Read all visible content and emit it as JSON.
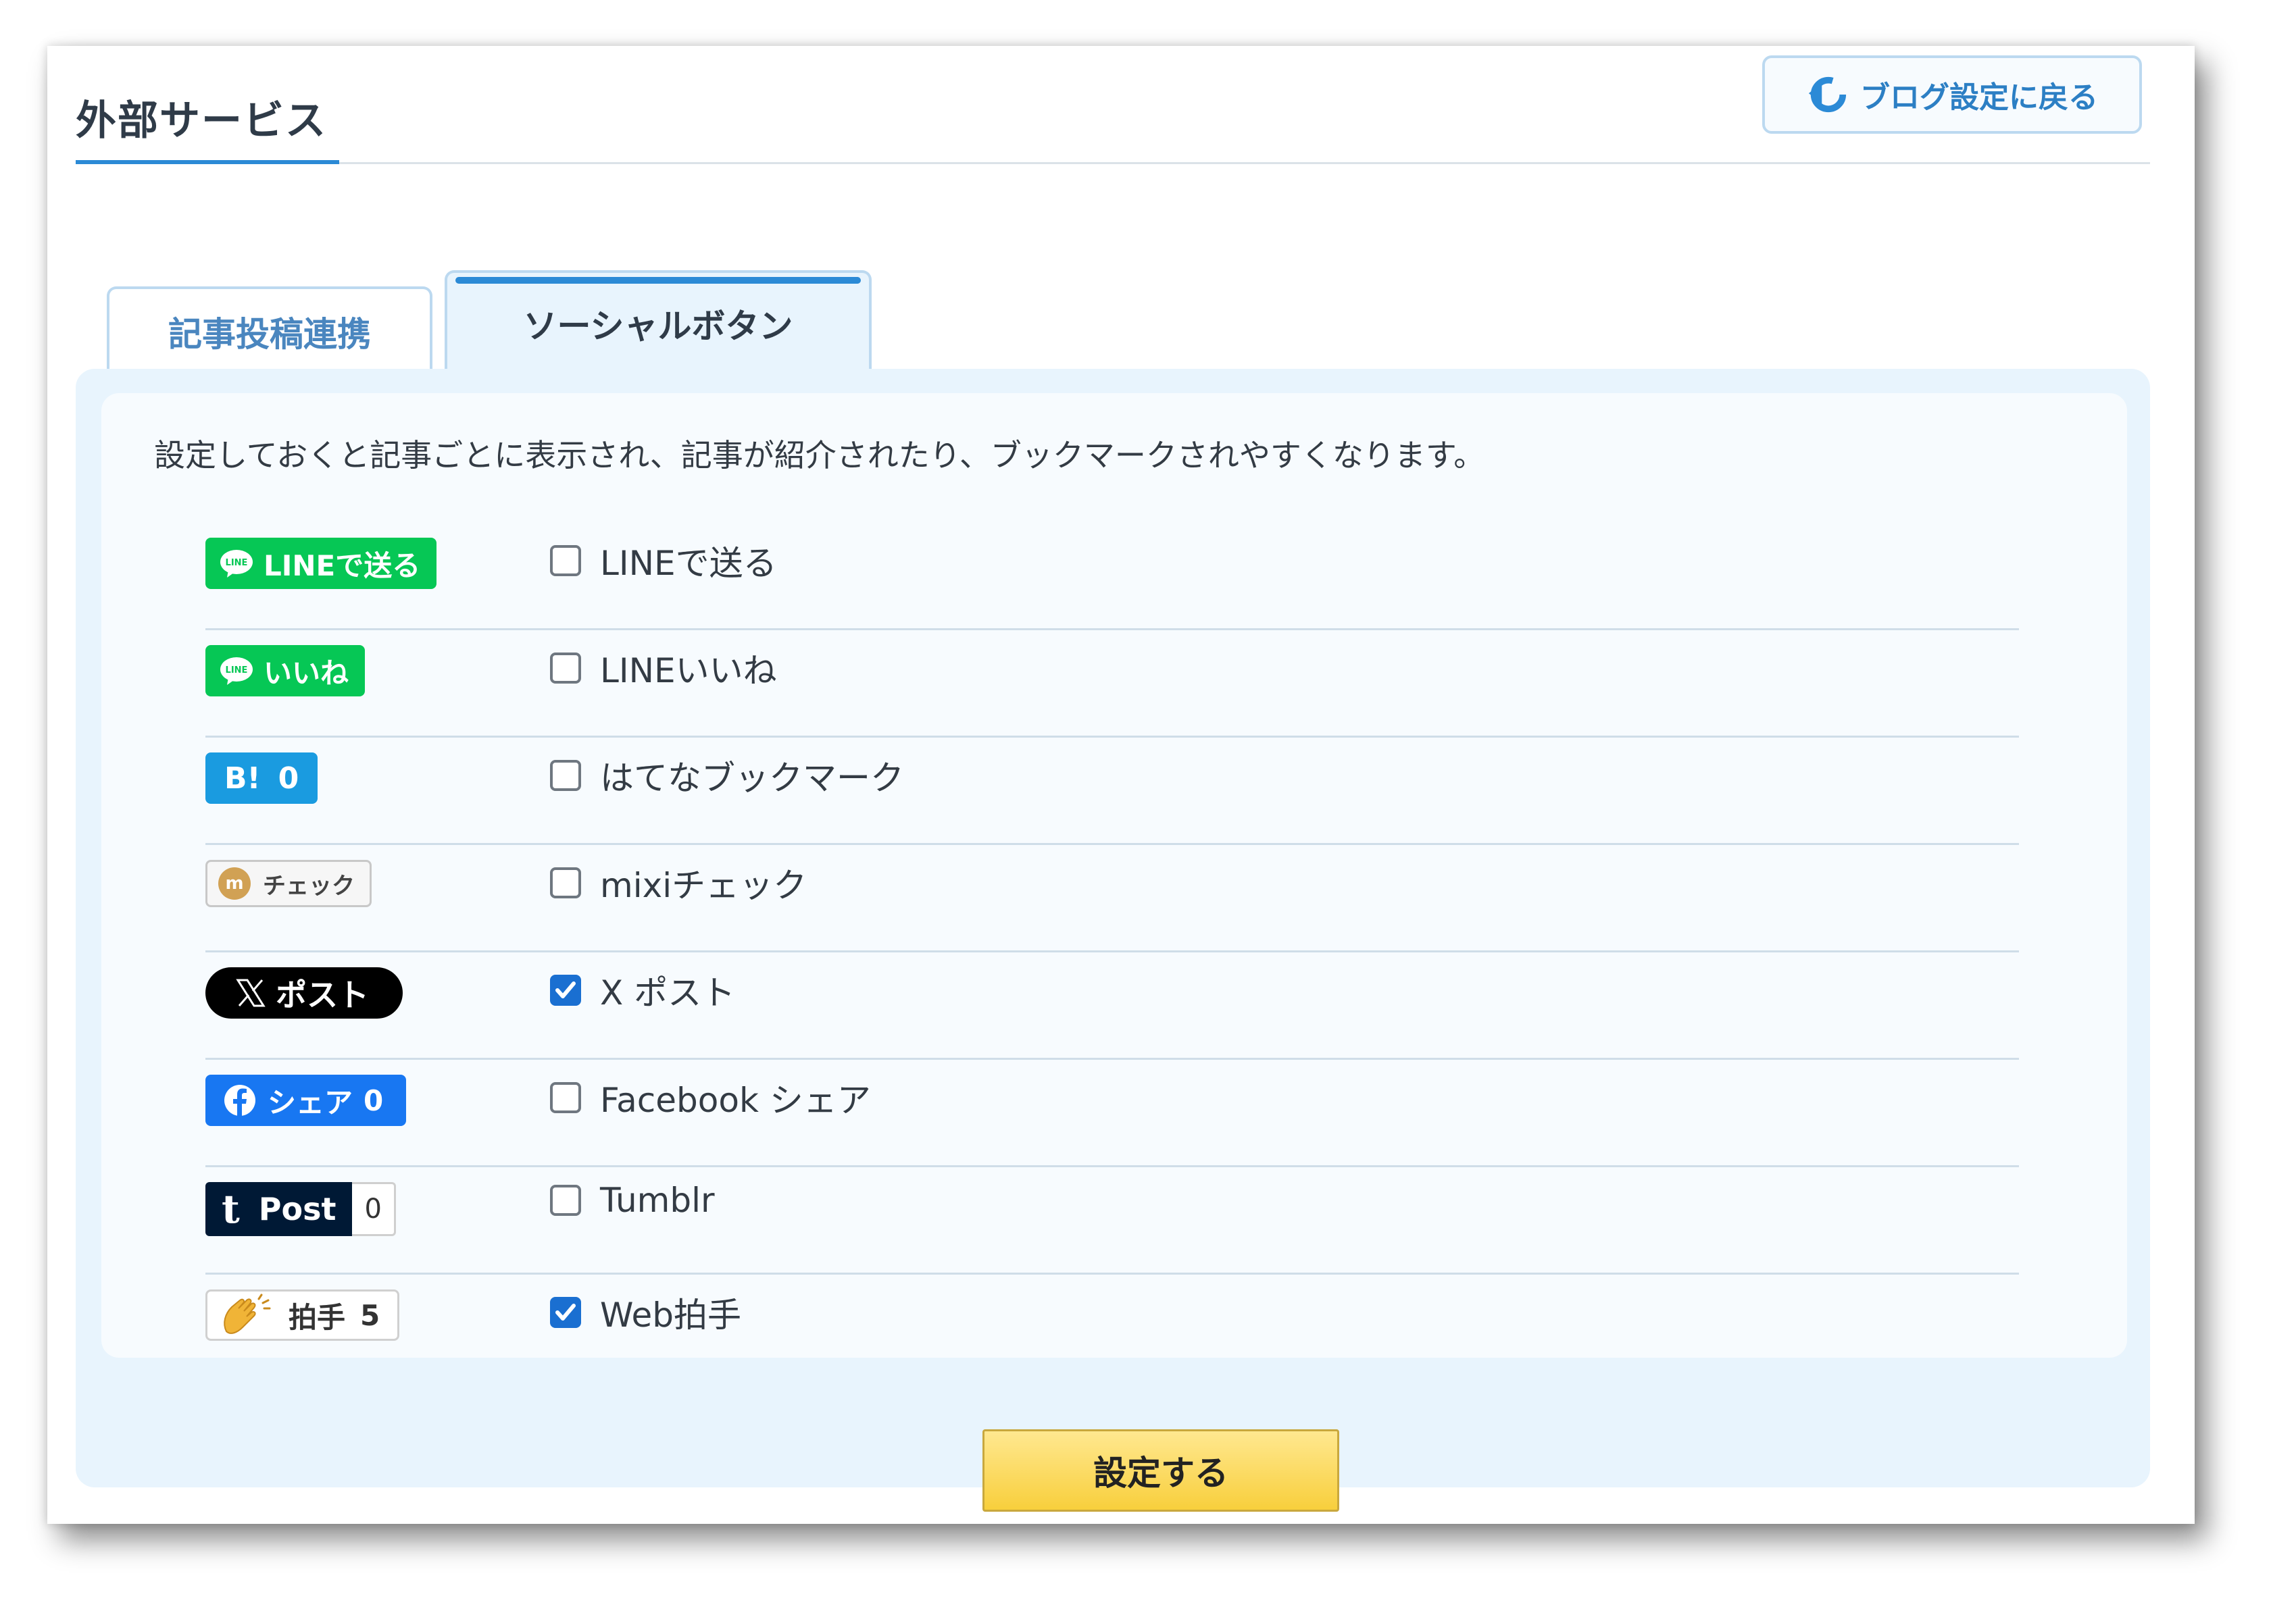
{
  "header": {
    "title": "外部サービス",
    "back_button": "ブログ設定に戻る"
  },
  "tabs": [
    {
      "label": "記事投稿連携",
      "active": false
    },
    {
      "label": "ソーシャルボタン",
      "active": true
    }
  ],
  "description": "設定しておくと記事ごとに表示され、記事が紹介されたり、ブックマークされやすくなります。",
  "badges": {
    "line_send": "LINEで送る",
    "line_like": "いいね",
    "hatena_logo": "B!",
    "hatena_count": "0",
    "mixi": "チェック",
    "x": "ポスト",
    "facebook": "シェア",
    "facebook_count": "0",
    "tumblr_logo": "t",
    "tumblr": "Post",
    "tumblr_count": "0",
    "clap": "拍手",
    "clap_count": "5"
  },
  "options": [
    {
      "label": "LINEで送る",
      "checked": false
    },
    {
      "label": "LINEいいね",
      "checked": false
    },
    {
      "label": "はてなブックマーク",
      "checked": false
    },
    {
      "label": "mixiチェック",
      "checked": false
    },
    {
      "label": "X ポスト",
      "checked": true
    },
    {
      "label": "Facebook シェア",
      "checked": false
    },
    {
      "label": "Tumblr",
      "checked": false
    },
    {
      "label": "Web拍手",
      "checked": true
    }
  ],
  "submit": "設定する",
  "colors": {
    "accent": "#2b8ad6",
    "panel": "#e8f4fd",
    "line_green": "#06c755",
    "hatena_blue": "#1a9be0",
    "facebook_blue": "#1877f2",
    "tumblr_navy": "#001935",
    "submit_yellow": "#f8cf3c"
  }
}
